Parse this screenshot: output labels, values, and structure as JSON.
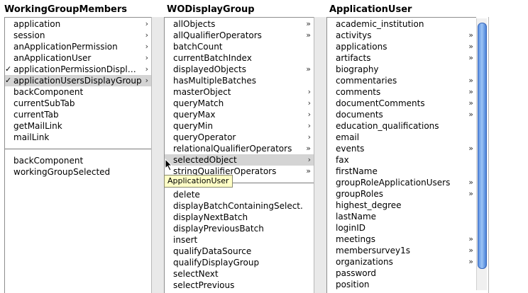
{
  "columns": [
    {
      "header": "WorkingGroupMembers",
      "items": [
        {
          "label": "application",
          "arrow": "›"
        },
        {
          "label": "session",
          "arrow": "›"
        },
        {
          "label": "anApplicationPermission",
          "arrow": "›"
        },
        {
          "label": "anApplicationUser",
          "arrow": "›"
        },
        {
          "label": "applicationPermissionDispl…",
          "arrow": "›",
          "check": "✓"
        },
        {
          "label": "applicationUsersDisplayGroup",
          "arrow": "›",
          "check": "✓",
          "selected": true
        },
        {
          "label": "backComponent"
        },
        {
          "label": "currentSubTab"
        },
        {
          "label": "currentTab"
        },
        {
          "label": "getMailLink"
        },
        {
          "label": "mailLink"
        }
      ],
      "actions": [
        {
          "label": "backComponent"
        },
        {
          "label": "workingGroupSelected"
        }
      ]
    },
    {
      "header": "WODisplayGroup",
      "items": [
        {
          "label": "allObjects",
          "arrow": "»"
        },
        {
          "label": "allQualifierOperators",
          "arrow": "»"
        },
        {
          "label": "batchCount"
        },
        {
          "label": "currentBatchIndex"
        },
        {
          "label": "displayedObjects",
          "arrow": "»"
        },
        {
          "label": "hasMultipleBatches"
        },
        {
          "label": "masterObject",
          "arrow": "›"
        },
        {
          "label": "queryMatch",
          "arrow": "›"
        },
        {
          "label": "queryMax",
          "arrow": "›"
        },
        {
          "label": "queryMin",
          "arrow": "›"
        },
        {
          "label": "queryOperator",
          "arrow": "›"
        },
        {
          "label": "relationalQualifierOperators",
          "arrow": "»"
        },
        {
          "label": "selectedObject",
          "arrow": "›",
          "selected": true
        },
        {
          "label": "stringQualifierOperators",
          "arrow": "»"
        }
      ],
      "actions": [
        {
          "label": "delete"
        },
        {
          "label": "displayBatchContainingSelect."
        },
        {
          "label": "displayNextBatch"
        },
        {
          "label": "displayPreviousBatch"
        },
        {
          "label": "insert"
        },
        {
          "label": "qualifyDataSource"
        },
        {
          "label": "qualifyDisplayGroup"
        },
        {
          "label": "selectNext"
        },
        {
          "label": "selectPrevious"
        }
      ]
    },
    {
      "header": "ApplicationUser",
      "items": [
        {
          "label": "academic_institution"
        },
        {
          "label": "activitys",
          "arrow": "»"
        },
        {
          "label": "applications",
          "arrow": "»"
        },
        {
          "label": "artifacts",
          "arrow": "»"
        },
        {
          "label": "biography"
        },
        {
          "label": "commentaries",
          "arrow": "»"
        },
        {
          "label": "comments",
          "arrow": "»"
        },
        {
          "label": "documentComments",
          "arrow": "»"
        },
        {
          "label": "documents",
          "arrow": "»"
        },
        {
          "label": "education_qualifications"
        },
        {
          "label": "email"
        },
        {
          "label": "events",
          "arrow": "»"
        },
        {
          "label": "fax"
        },
        {
          "label": "firstName"
        },
        {
          "label": "groupRoleApplicationUsers",
          "arrow": "»"
        },
        {
          "label": "groupRoles",
          "arrow": "»"
        },
        {
          "label": "highest_degree"
        },
        {
          "label": "lastName"
        },
        {
          "label": "loginID"
        },
        {
          "label": "meetings",
          "arrow": "»"
        },
        {
          "label": "membersurvey1s",
          "arrow": "»"
        },
        {
          "label": "organizations",
          "arrow": "»"
        },
        {
          "label": "password"
        },
        {
          "label": "position"
        }
      ]
    }
  ],
  "tooltip": "ApplicationUser",
  "colors": {
    "selection": "#d4d4d4",
    "tooltip_bg": "#ffffc6",
    "scroll_thumb": "#6b9be8"
  }
}
